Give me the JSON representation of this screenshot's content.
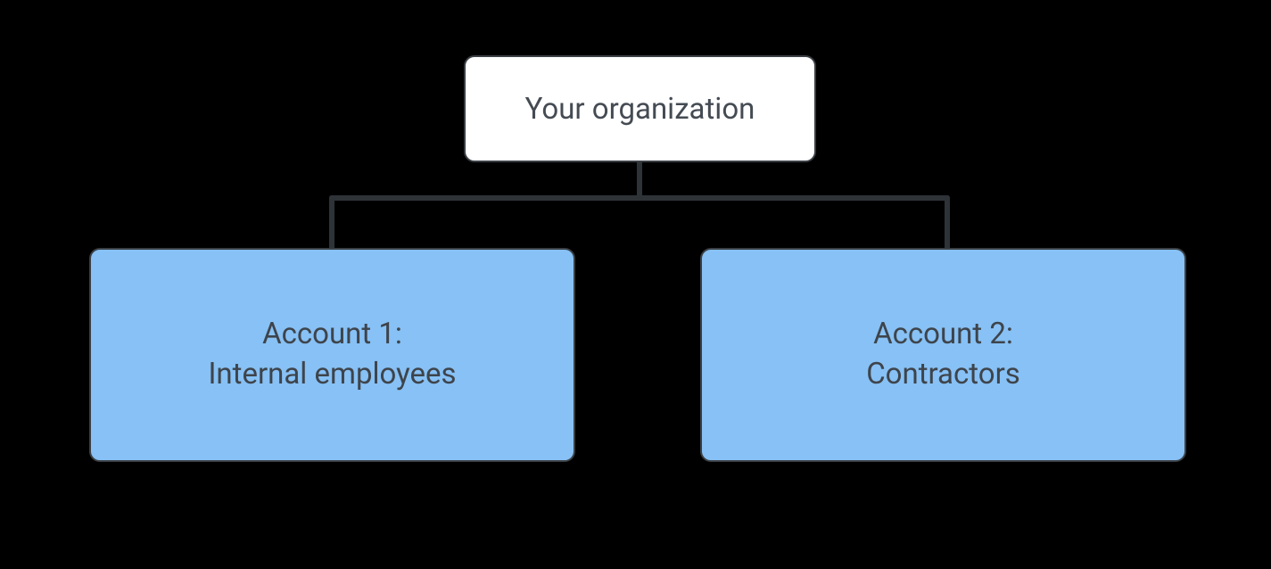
{
  "root": {
    "label": "Your organization"
  },
  "children": {
    "left": {
      "line1": "Account 1:",
      "line2": "Internal employees"
    },
    "right": {
      "line1": "Account 2:",
      "line2": "Contractors"
    }
  },
  "colors": {
    "child_fill": "#87c1f5",
    "root_fill": "#ffffff",
    "stroke": "#3a3f44",
    "text": "#454b53"
  }
}
